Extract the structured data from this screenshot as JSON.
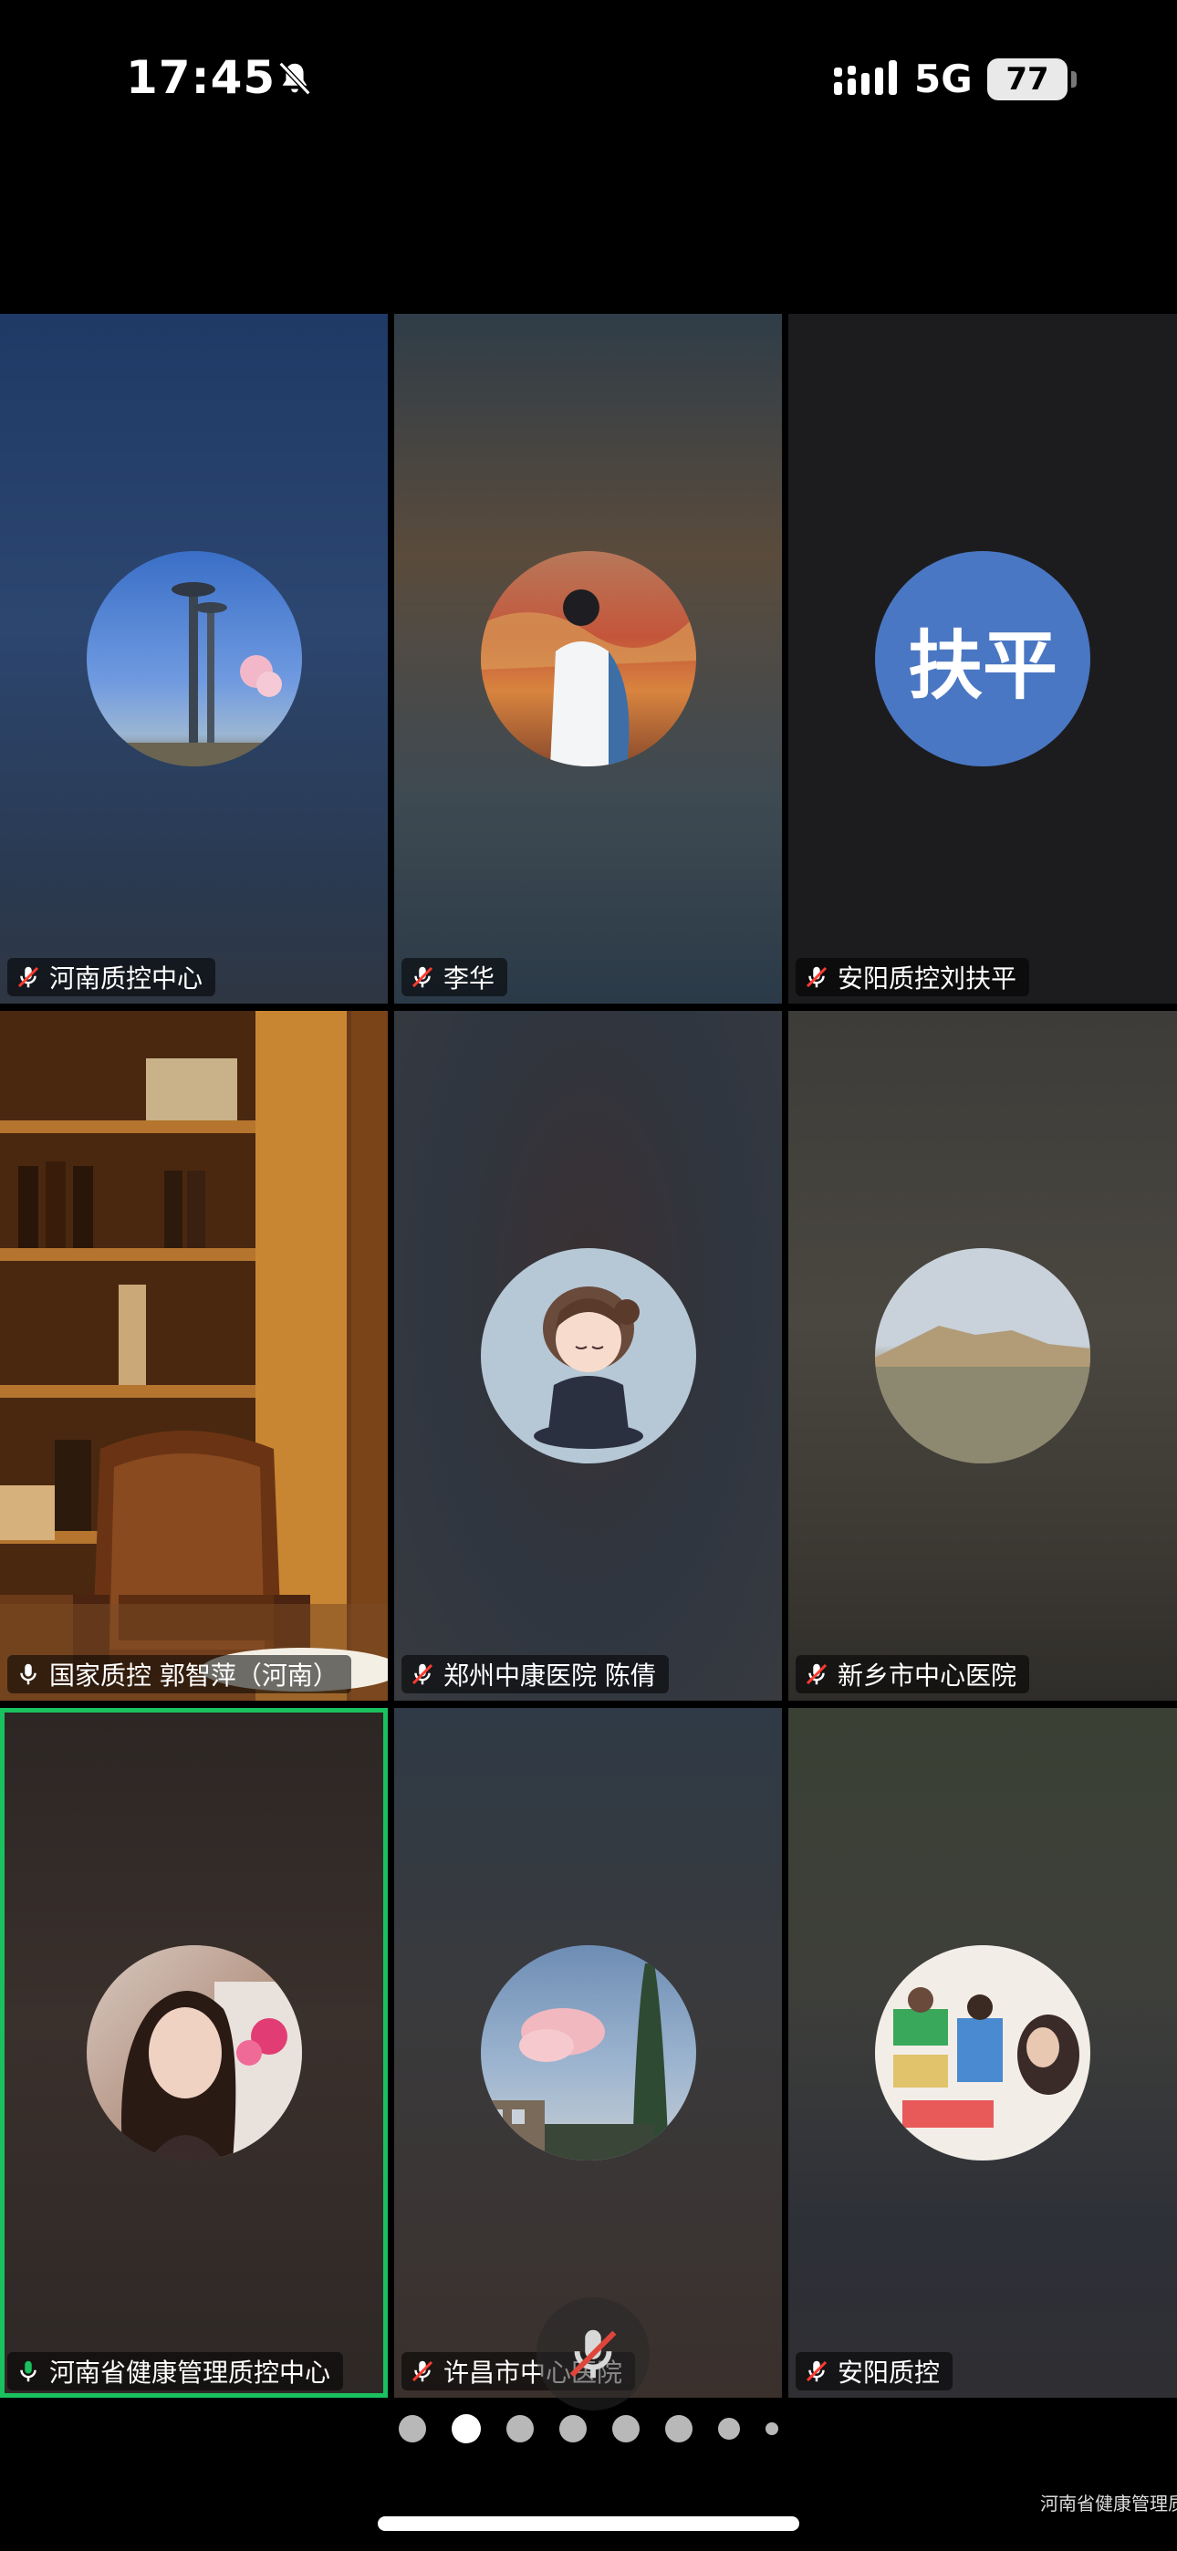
{
  "status_bar": {
    "time": "17:45",
    "network": "5G",
    "battery": "77"
  },
  "participants": [
    {
      "name": "河南质控中心",
      "muted": true,
      "avatar": "tower-photo"
    },
    {
      "name": "李华",
      "muted": true,
      "avatar": "person-landscape-photo"
    },
    {
      "name": "安阳质控刘扶平",
      "muted": true,
      "avatar_text": "扶平",
      "avatar_color": "#4a77c3"
    },
    {
      "name": "国家质控 郭智萍（河南）",
      "muted": false,
      "video": "bookshelf-office"
    },
    {
      "name": "郑州中康医院  陈倩",
      "muted": true,
      "avatar": "cartoon-girl"
    },
    {
      "name": "新乡市中心医院",
      "muted": true,
      "avatar": "desert-landscape"
    },
    {
      "name": "河南省健康管理质控中心",
      "muted": false,
      "active_speaker": true,
      "active_color": "#19c15f",
      "avatar": "woman-portrait"
    },
    {
      "name": "许昌市中心医院",
      "muted": true,
      "avatar": "sky-tree-photo"
    },
    {
      "name": "安阳质控",
      "muted": true,
      "avatar": "children-photo"
    }
  ],
  "pagination": {
    "pages": 8,
    "current": 2
  },
  "footer_caption": "河南省健康管理质控中心"
}
